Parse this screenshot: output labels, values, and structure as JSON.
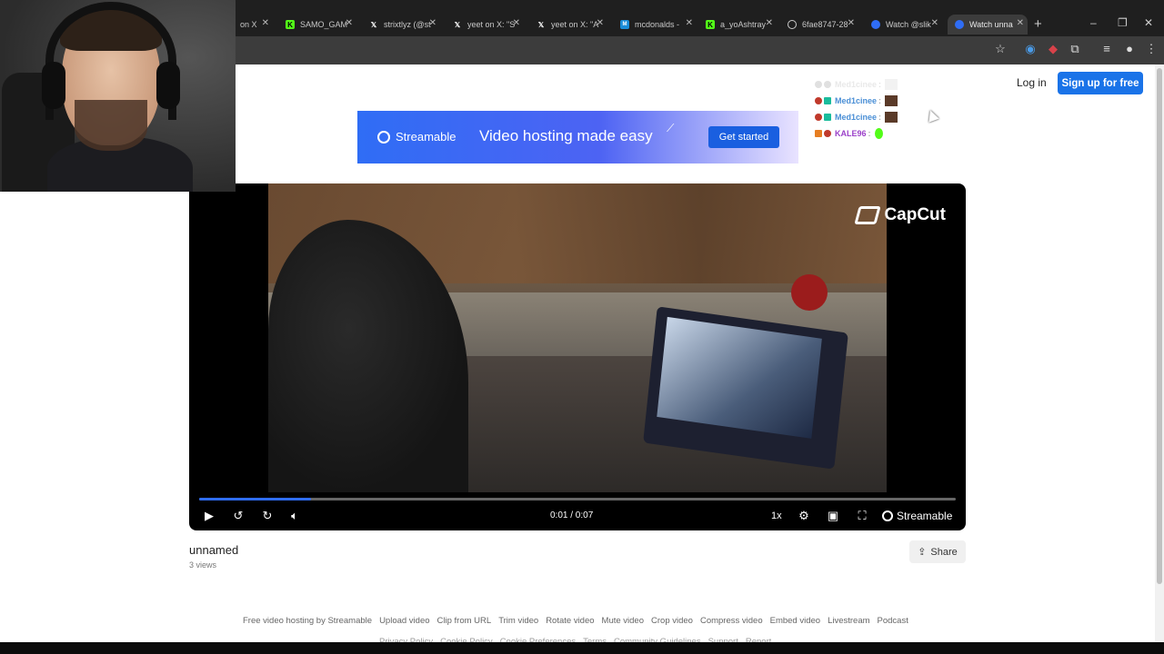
{
  "browser": {
    "tabs": [
      {
        "label": "on X",
        "icon": "x-icon",
        "active": false
      },
      {
        "label": "SAMO_GAM",
        "icon": "kick-icon",
        "active": false
      },
      {
        "label": "strixtlyz (@st",
        "icon": "x-icon",
        "active": false
      },
      {
        "label": "yeet on X: \"S",
        "icon": "x-icon",
        "active": false
      },
      {
        "label": "yeet on X: \"A",
        "icon": "x-icon",
        "active": false
      },
      {
        "label": "mcdonalds -",
        "icon": "kick-badge-icon",
        "active": false
      },
      {
        "label": "a_yoAshtray",
        "icon": "kick-icon",
        "active": false
      },
      {
        "label": "6fae8747-28",
        "icon": "globe-icon",
        "active": false
      },
      {
        "label": "Watch @slik",
        "icon": "streamable-icon",
        "active": false
      },
      {
        "label": "Watch unna",
        "icon": "streamable-icon",
        "active": true
      }
    ],
    "new_tab": "+",
    "window_controls": [
      "–",
      "❐",
      "✕"
    ]
  },
  "header": {
    "login_label": "Log in",
    "signup_label": "Sign up for free"
  },
  "banner": {
    "brand": "Streamable",
    "tagline": "Video hosting made easy",
    "cta_label": "Get started"
  },
  "chat": {
    "messages": [
      {
        "name": "Med1cinee",
        "sep": ":",
        "color": "#a8a8a8",
        "faded": true
      },
      {
        "name": "Med1cinee",
        "sep": ":",
        "color": "#4a8fd6",
        "faded": false
      },
      {
        "name": "Med1cinee",
        "sep": ":",
        "color": "#4a8fd6",
        "faded": false
      },
      {
        "name": "KALE96",
        "sep": ":",
        "color": "#9b40c9",
        "faded": false
      }
    ]
  },
  "player": {
    "watermark": "CapCut",
    "current_time": "0:01",
    "duration": "0:07",
    "time_display": "0:01 / 0:07",
    "speed": "1x",
    "brand": "Streamable",
    "progress": 0.148
  },
  "video_info": {
    "title": "unnamed",
    "views": "3 views",
    "share_label": "Share"
  },
  "footer": {
    "links": [
      "Free video hosting by Streamable",
      "Upload video",
      "Clip from URL",
      "Trim video",
      "Rotate video",
      "Mute video",
      "Crop video",
      "Compress video",
      "Embed video",
      "Livestream",
      "Podcast"
    ],
    "links2": [
      "Privacy Policy",
      "Cookie Policy",
      "Cookie Preferences",
      "Terms",
      "Community Guidelines",
      "Support",
      "Report"
    ]
  },
  "colors": {
    "accent": "#1a73e8",
    "progress": "#2f6df5"
  }
}
